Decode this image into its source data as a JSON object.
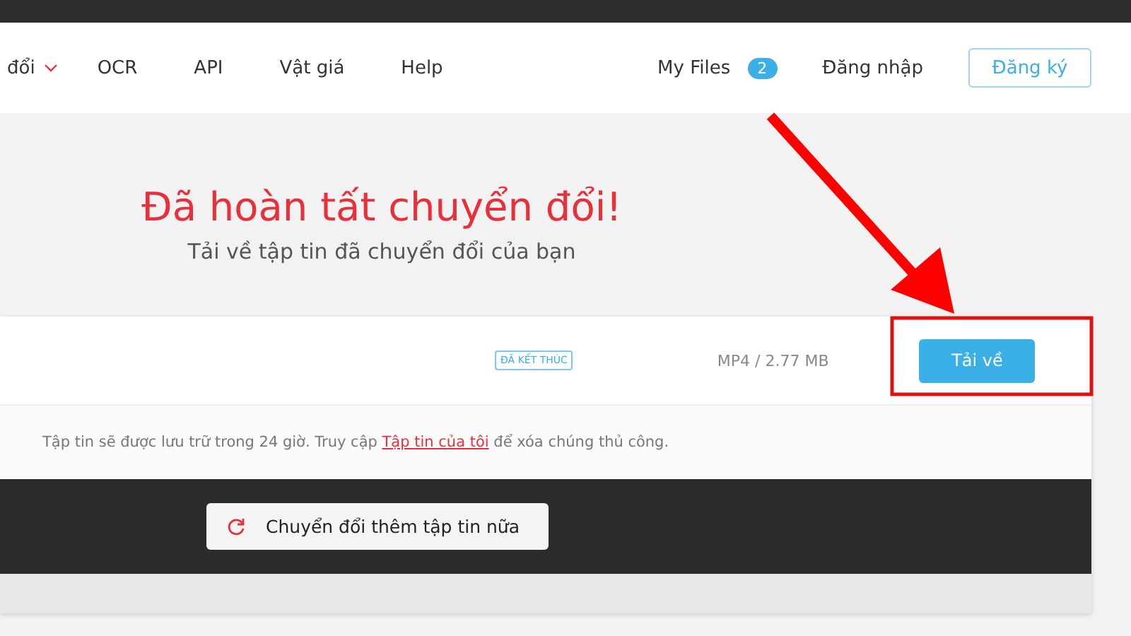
{
  "nav": {
    "items": [
      {
        "label": "đổi",
        "dropdown": true
      },
      {
        "label": "OCR",
        "dropdown": false
      },
      {
        "label": "API",
        "dropdown": false
      },
      {
        "label": "Vật giá",
        "dropdown": false
      },
      {
        "label": "Help",
        "dropdown": false
      }
    ],
    "my_files": {
      "label": "My Files",
      "count": "2"
    },
    "login": "Đăng nhập",
    "signup": "Đăng ký"
  },
  "heading": {
    "title": "Đã hoàn tất chuyển đổi!",
    "subtitle": "Tải về tập tin đã chuyển đổi của bạn"
  },
  "file": {
    "status": "ĐÃ KẾT THÚC",
    "info": "MP4 / 2.77 MB",
    "download": "Tải về"
  },
  "notice": {
    "before": "Tập tin sẽ được lưu trữ trong 24 giờ. Truy cập",
    "link": "Tập tin của tôi",
    "after": "để xóa chúng thủ công."
  },
  "convert_more": "Chuyển đổi thêm tập tin nữa",
  "annotation": {
    "arrow": true,
    "highlight": true
  }
}
